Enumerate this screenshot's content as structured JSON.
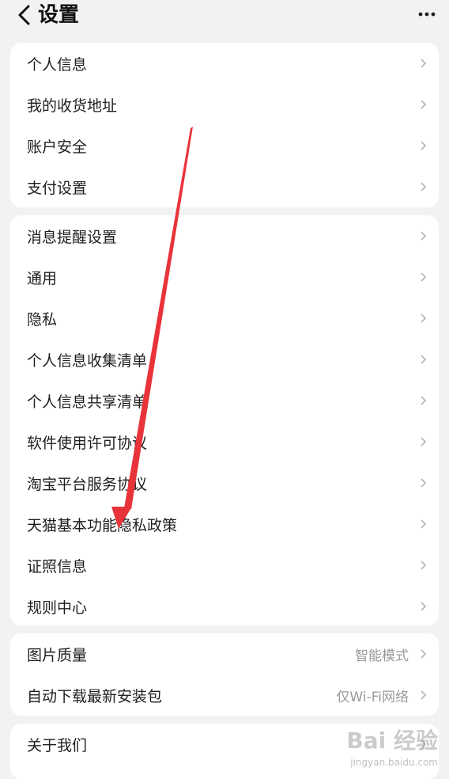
{
  "header": {
    "title": "设置",
    "back_icon": "chevron-left-icon",
    "more_icon": "more-dots-icon"
  },
  "groups": [
    {
      "items": [
        {
          "label": "个人信息"
        },
        {
          "label": "我的收货地址"
        },
        {
          "label": "账户安全"
        },
        {
          "label": "支付设置"
        }
      ]
    },
    {
      "items": [
        {
          "label": "消息提醒设置"
        },
        {
          "label": "通用"
        },
        {
          "label": "隐私"
        },
        {
          "label": "个人信息收集清单"
        },
        {
          "label": "个人信息共享清单"
        },
        {
          "label": "软件使用许可协议"
        },
        {
          "label": "淘宝平台服务协议"
        },
        {
          "label": "天猫基本功能隐私政策"
        },
        {
          "label": "证照信息"
        },
        {
          "label": "规则中心"
        }
      ]
    },
    {
      "items": [
        {
          "label": "图片质量",
          "value": "智能模式"
        },
        {
          "label": "自动下载最新安装包",
          "value": "仅Wi-Fi网络"
        }
      ]
    },
    {
      "items": [
        {
          "label": "关于我们"
        }
      ]
    }
  ],
  "watermark": {
    "main": "Bai 经验",
    "sub": "jingyan.baidu.com"
  },
  "colors": {
    "background": "#f2f2f3",
    "card": "#ffffff",
    "annotation_arrow": "#e8333a"
  }
}
